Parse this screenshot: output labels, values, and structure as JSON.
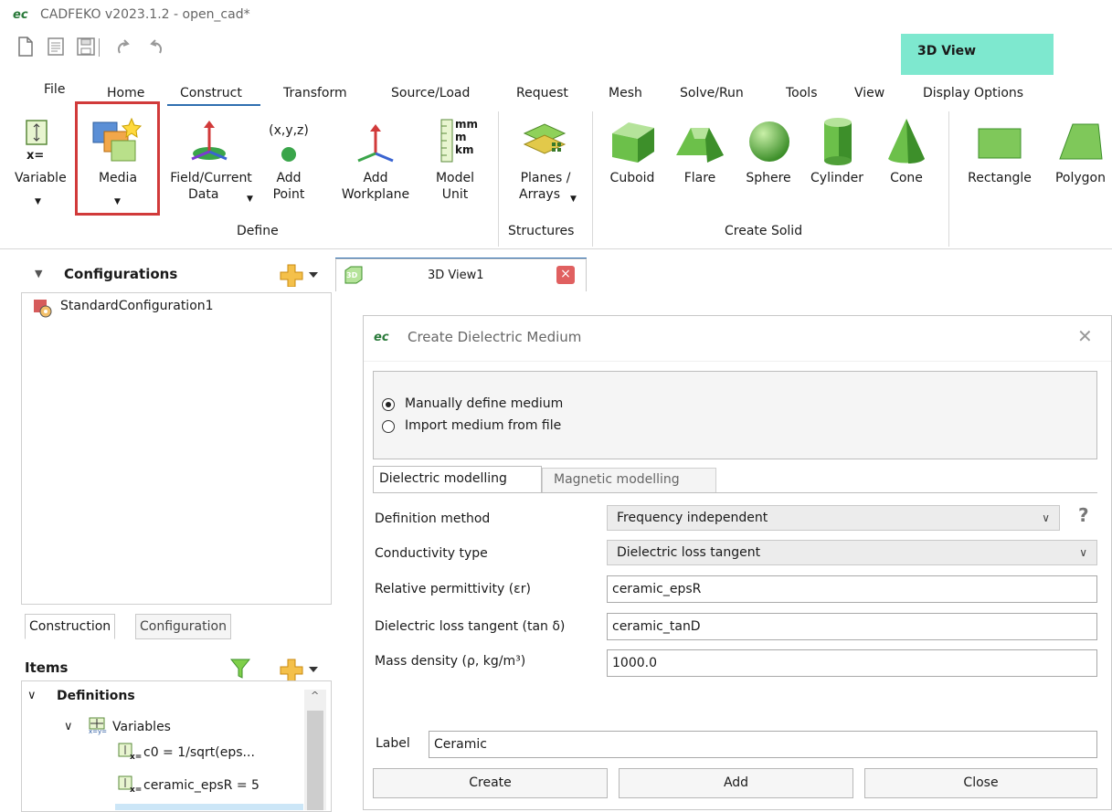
{
  "window": {
    "title": "CADFEKO v2023.1.2 - open_cad*",
    "logo": "ec"
  },
  "quick_access": {
    "icons": [
      "new-file-icon",
      "open-file-icon",
      "save-icon",
      "undo-icon",
      "redo-icon"
    ]
  },
  "context_tab": {
    "label": "3D View",
    "color": "#7ee8cf"
  },
  "menu": {
    "tabs": [
      "File",
      "Home",
      "Construct",
      "Transform",
      "Source/Load",
      "Request",
      "Mesh",
      "Solve/Run",
      "Tools",
      "View",
      "Display Options"
    ],
    "active": "Construct",
    "accent": "#2f6fb0"
  },
  "ribbon": {
    "define": {
      "group_label": "Define",
      "buttons": [
        {
          "label1": "Variable",
          "label2": ""
        },
        {
          "label1": "Media",
          "label2": ""
        },
        {
          "label1": "Field/Current",
          "label2": "Data"
        },
        {
          "label1": "Add",
          "label2": "Point",
          "icon_text": "(x,y,z)"
        },
        {
          "label1": "Add",
          "label2": "Workplane"
        },
        {
          "label1": "Model",
          "label2": "Unit"
        }
      ],
      "variable_icon_text": "x=",
      "unit_icon_text": [
        "mm",
        "m",
        "km"
      ]
    },
    "structures": {
      "group_label": "Structures",
      "button_label1": "Planes /",
      "button_label2": "Arrays"
    },
    "create_solid": {
      "group_label": "Create Solid",
      "buttons": [
        "Cuboid",
        "Flare",
        "Sphere",
        "Cylinder",
        "Cone"
      ]
    },
    "surfaces": {
      "buttons": [
        "Rectangle",
        "Polygon"
      ]
    },
    "highlight_color": "#d13a3a"
  },
  "left_panel": {
    "configurations_header": "Configurations",
    "configurations": [
      "StandardConfiguration1"
    ],
    "tabs": [
      "Construction",
      "Configuration"
    ],
    "items_header": "Items",
    "tree": {
      "definitions": "Definitions",
      "variables": "Variables",
      "variables_icon_text": "x=y=",
      "var_icon_text": "x=",
      "items": [
        "c0 = 1/sqrt(eps...",
        "ceramic_epsR = 5"
      ]
    }
  },
  "document_tab": {
    "label": "3D View1",
    "icon_text": "3D"
  },
  "dialog": {
    "title": "Create Dielectric Medium",
    "radio_options": [
      {
        "label": "Manually define medium",
        "selected": true
      },
      {
        "label": "Import medium from file",
        "selected": false
      }
    ],
    "tabs": [
      "Dielectric modelling",
      "Magnetic modelling"
    ],
    "active_tab": "Dielectric modelling",
    "fields": {
      "definition_method": {
        "label": "Definition method",
        "value": "Frequency independent"
      },
      "conductivity_type": {
        "label": "Conductivity type",
        "value": "Dielectric loss tangent"
      },
      "relative_permittivity": {
        "label": "Relative permittivity (εr)",
        "value": "ceramic_epsR"
      },
      "loss_tangent": {
        "label": "Dielectric loss tangent (tan δ)",
        "value": "ceramic_tanD"
      },
      "mass_density": {
        "label": "Mass density (ρ, kg/m³)",
        "value": "1000.0"
      }
    },
    "help_symbol": "?",
    "label_field": {
      "label": "Label",
      "value": "Ceramic"
    },
    "buttons": {
      "create": "Create",
      "add": "Add",
      "close": "Close"
    }
  }
}
